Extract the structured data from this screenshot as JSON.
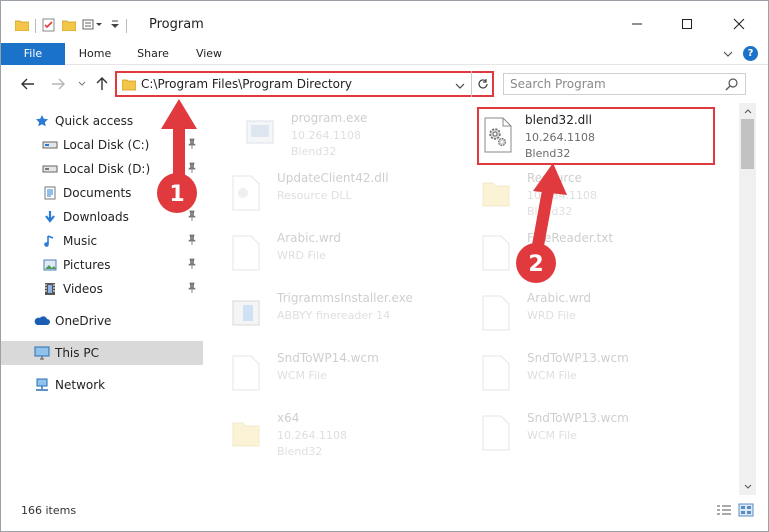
{
  "window": {
    "title": "Program"
  },
  "ribbon": {
    "tabs": [
      "File",
      "Home",
      "Share",
      "View"
    ]
  },
  "address": {
    "path": "C:\\Program Files\\Program Directory"
  },
  "search": {
    "placeholder": "Search Program"
  },
  "navpane": {
    "items": [
      {
        "label": "Quick access",
        "icon": "star-icon",
        "pinned": false
      },
      {
        "label": "Local Disk (C:)",
        "icon": "drive-icon",
        "pinned": true
      },
      {
        "label": "Local Disk (D:)",
        "icon": "drive-icon",
        "pinned": true
      },
      {
        "label": "Documents",
        "icon": "documents-icon",
        "pinned": true
      },
      {
        "label": "Downloads",
        "icon": "downloads-icon",
        "pinned": true
      },
      {
        "label": "Music",
        "icon": "music-icon",
        "pinned": true
      },
      {
        "label": "Pictures",
        "icon": "pictures-icon",
        "pinned": true
      },
      {
        "label": "Videos",
        "icon": "videos-icon",
        "pinned": true
      },
      {
        "label": "OneDrive",
        "icon": "onedrive-icon",
        "pinned": false
      },
      {
        "label": "This PC",
        "icon": "computer-icon",
        "pinned": false,
        "selected": true
      },
      {
        "label": "Network",
        "icon": "network-icon",
        "pinned": false
      }
    ]
  },
  "files": [
    {
      "name": "program.exe",
      "sub1": "10.264.1108",
      "sub2": "Blend32",
      "type": "exe"
    },
    {
      "name": "blend32.dll",
      "sub1": "10.264.1108",
      "sub2": "Blend32",
      "type": "dll",
      "highlight": true
    },
    {
      "name": "UpdateClient42.dll",
      "sub1": "Resource DLL",
      "sub2": "",
      "type": "dll"
    },
    {
      "name": "Resource",
      "sub1": "10.264.1108",
      "sub2": "Blend32",
      "type": "folder"
    },
    {
      "name": "Arabic.wrd",
      "sub1": "WRD File",
      "sub2": "",
      "type": "doc"
    },
    {
      "name": "FineReader.txt",
      "sub1": "Text",
      "sub2": "",
      "type": "doc"
    },
    {
      "name": "TrigrammsInstaller.exe",
      "sub1": "ABBYY finereader 14",
      "sub2": "",
      "type": "installer"
    },
    {
      "name": "Arabic.wrd",
      "sub1": "WRD File",
      "sub2": "",
      "type": "doc"
    },
    {
      "name": "SndToWP14.wcm",
      "sub1": "WCM File",
      "sub2": "",
      "type": "doc"
    },
    {
      "name": "SndToWP13.wcm",
      "sub1": "WCM File",
      "sub2": "",
      "type": "doc"
    },
    {
      "name": "x64",
      "sub1": "10.264.1108",
      "sub2": "Blend32",
      "type": "folder"
    },
    {
      "name": "SndToWP13.wcm",
      "sub1": "WCM File",
      "sub2": "",
      "type": "doc"
    }
  ],
  "status": {
    "item_count": "166 items"
  },
  "annotations": {
    "step1": "1",
    "step2": "2",
    "color": "#e0393e"
  }
}
